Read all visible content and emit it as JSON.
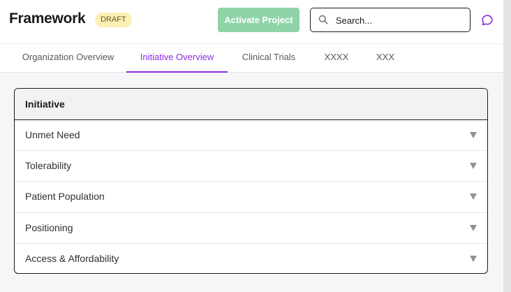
{
  "header": {
    "title": "Framework",
    "badge": "DRAFT",
    "activate_label": "Activate Project",
    "search_placeholder": "Search...",
    "icons": {
      "search": "search-icon",
      "chat": "chat-bubble-icon"
    },
    "colors": {
      "accent": "#8a2be2",
      "activate_button": "#8fd4a8",
      "badge_bg": "#fbf0b4"
    }
  },
  "tabs": [
    {
      "label": "Organization Overview",
      "active": false
    },
    {
      "label": "Initiative Overview",
      "active": true
    },
    {
      "label": "Clinical Trials",
      "active": false
    },
    {
      "label": "XXXX",
      "active": false
    },
    {
      "label": "XXX",
      "active": false
    }
  ],
  "section": {
    "heading": "Initiative",
    "items": [
      {
        "label": "Unmet Need",
        "icon": "chevron-down-icon"
      },
      {
        "label": "Tolerability",
        "icon": "chevron-down-icon"
      },
      {
        "label": "Patient Population",
        "icon": "chevron-down-icon"
      },
      {
        "label": "Positioning",
        "icon": "chevron-down-icon"
      },
      {
        "label": "Access & Affordability",
        "icon": "chevron-down-icon"
      }
    ]
  }
}
